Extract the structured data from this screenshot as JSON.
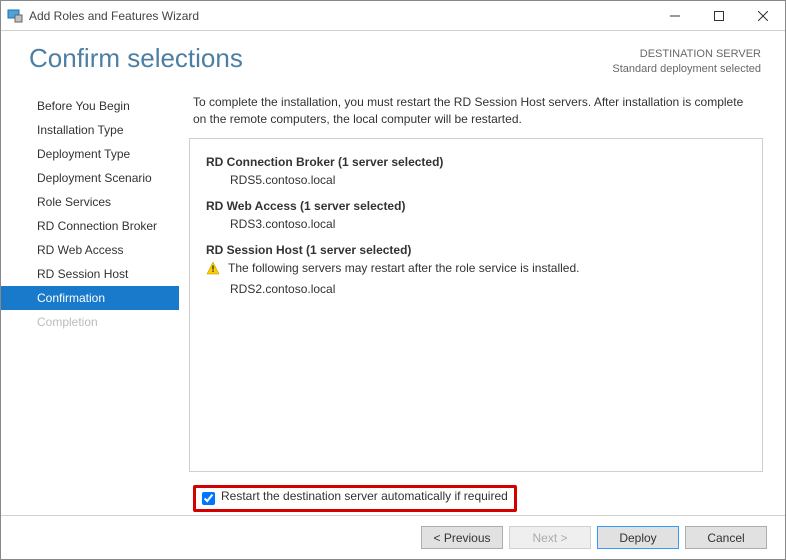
{
  "window": {
    "title": "Add Roles and Features Wizard"
  },
  "header": {
    "title": "Confirm selections",
    "destination_label": "DESTINATION SERVER",
    "destination_value": "Standard deployment selected"
  },
  "sidebar": {
    "items": [
      {
        "label": "Before You Begin",
        "active": false,
        "disabled": false
      },
      {
        "label": "Installation Type",
        "active": false,
        "disabled": false
      },
      {
        "label": "Deployment Type",
        "active": false,
        "disabled": false
      },
      {
        "label": "Deployment Scenario",
        "active": false,
        "disabled": false
      },
      {
        "label": "Role Services",
        "active": false,
        "disabled": false
      },
      {
        "label": "RD Connection Broker",
        "active": false,
        "disabled": false
      },
      {
        "label": "RD Web Access",
        "active": false,
        "disabled": false
      },
      {
        "label": "RD Session Host",
        "active": false,
        "disabled": false
      },
      {
        "label": "Confirmation",
        "active": true,
        "disabled": false
      },
      {
        "label": "Completion",
        "active": false,
        "disabled": true
      }
    ]
  },
  "main": {
    "intro": "To complete the installation, you must restart the RD Session Host servers. After installation is complete on the remote computers, the local computer will be restarted.",
    "roles": [
      {
        "title": "RD Connection Broker  (1 server selected)",
        "warning": null,
        "server": "RDS5.contoso.local"
      },
      {
        "title": "RD Web Access  (1 server selected)",
        "warning": null,
        "server": "RDS3.contoso.local"
      },
      {
        "title": "RD Session Host  (1 server selected)",
        "warning": "The following servers may restart after the role service is installed.",
        "server": "RDS2.contoso.local"
      }
    ],
    "restart_checkbox": {
      "label": "Restart the destination server automatically if required",
      "checked": true
    }
  },
  "footer": {
    "previous": "< Previous",
    "next": "Next >",
    "deploy": "Deploy",
    "cancel": "Cancel"
  }
}
